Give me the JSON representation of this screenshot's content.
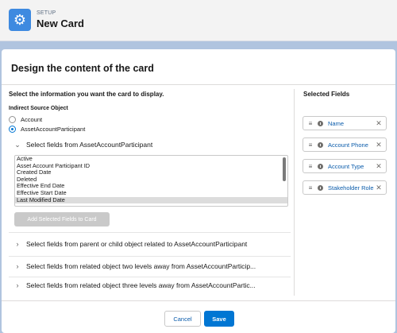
{
  "header": {
    "eyebrow": "SETUP",
    "title": "New Card",
    "icon": "gear-icon"
  },
  "card": {
    "title": "Design the content of the card",
    "instruction": "Select the information you want the card to display.",
    "source_label": "Indirect Source Object",
    "source_options": [
      {
        "label": "Account",
        "selected": false
      },
      {
        "label": "AssetAccountParticipant",
        "selected": true
      }
    ],
    "fields_section": {
      "label": "Select fields from AssetAccountParticipant",
      "expanded": true,
      "options": [
        "Active",
        "Asset Account Participant ID",
        "Created Date",
        "Deleted",
        "Effective End Date",
        "Effective Start Date",
        "Last Modified Date"
      ],
      "selected_option": "Last Modified Date",
      "add_button": "Add Selected Fields to Card"
    },
    "collapsed_sections": [
      "Select fields from parent or child object related to AssetAccountParticipant",
      "Select fields from related object two levels away from AssetAccountParticip...",
      "Select fields from related object three levels away from AssetAccountPartic..."
    ],
    "selected_fields_title": "Selected Fields",
    "selected_fields": [
      "Name",
      "Account Phone",
      "Account Type",
      "Stakeholder Role"
    ]
  },
  "footer": {
    "cancel": "Cancel",
    "save": "Save"
  },
  "colors": {
    "brand": "#0176d3",
    "link": "#0b5cab",
    "page_bg": "#b0c4df"
  }
}
